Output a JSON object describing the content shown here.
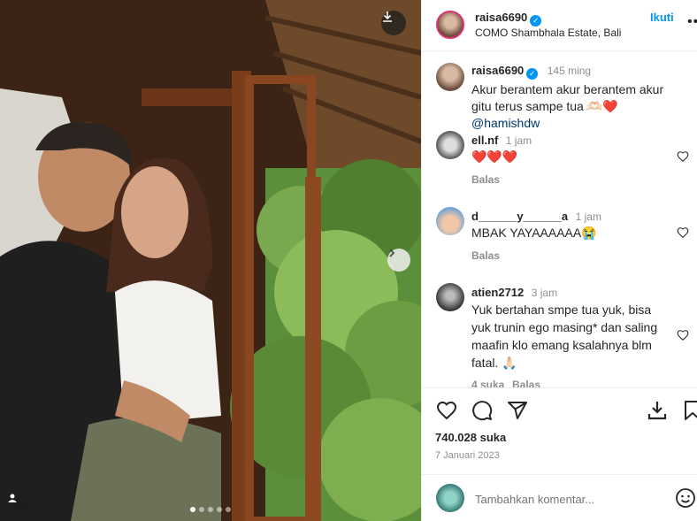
{
  "post": {
    "author": "raisa6690",
    "location": "COMO Shambhala Estate, Bali",
    "follow_label": "Ikuti",
    "more_icon": "more-horizontal-icon",
    "verified_icon": "verified-badge-icon"
  },
  "caption": {
    "author": "raisa6690",
    "time": "145 ming",
    "text": "Akur berantem akur berantem akur gitu terus sampe tua 🫶🏻❤️",
    "mention": "@hamishdw"
  },
  "comments": [
    {
      "user": "ell.nf",
      "time": "1 jam",
      "text": "❤️❤️❤️",
      "reply": "Balas"
    },
    {
      "user": "d______y______a",
      "time": "1 jam",
      "text": "MBAK YAYAAAAAA😭",
      "reply": "Balas"
    },
    {
      "user": "atien2712",
      "time": "3 jam",
      "text": "Yuk bertahan smpe tua yuk, bisa yuk trunin ego masing* dan saling maafin klo emang ksalahnya blm fatal. 🙏🏻",
      "likes": "4 suka",
      "reply": "Balas"
    }
  ],
  "actions": {
    "likes": "740.028 suka",
    "date": "7 Januari 2023",
    "icons": [
      "heart-icon",
      "comment-icon",
      "share-icon",
      "save-icon"
    ]
  },
  "add_comment": {
    "placeholder": "Tambahkan komentar...",
    "emoji_icon": "emoji-icon"
  },
  "media": {
    "download_icon": "download-icon",
    "next_icon": "chevron-right-icon",
    "tag_icon": "user-tag-icon",
    "slide_count": 5,
    "active_slide": 1
  },
  "colors": {
    "link": "#0095f6",
    "heart": "#ed4956",
    "muted": "#8e8e8e"
  }
}
